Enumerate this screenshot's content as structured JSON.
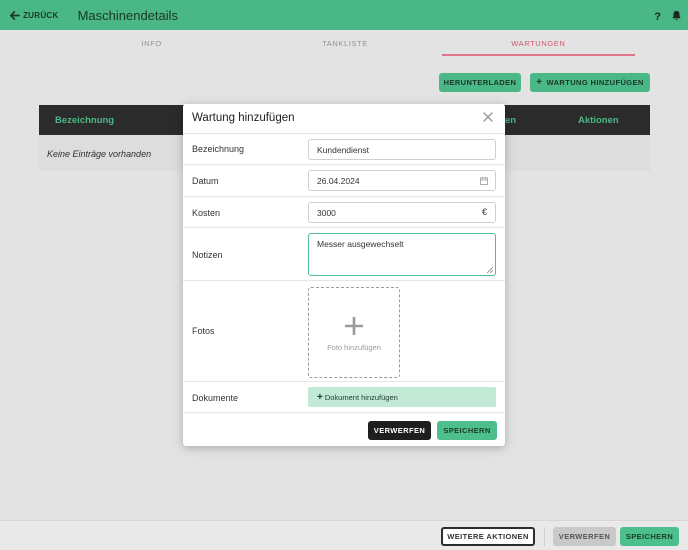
{
  "header": {
    "back_label": "ZURÜCK",
    "title": "Maschinendetails",
    "help": "?"
  },
  "tabs": [
    {
      "label": "INFO"
    },
    {
      "label": "TANKLISTE"
    },
    {
      "label": "WARTUNGEN",
      "active": true
    }
  ],
  "toolbar": {
    "download_label": "HERUNTERLADEN",
    "add_label": "WARTUNG HINZUFÜGEN"
  },
  "table": {
    "headers": {
      "bezeichnung": "Bezeichnung",
      "partial": "en",
      "aktionen": "Aktionen"
    },
    "empty_text": "Keine Einträge vorhanden"
  },
  "modal": {
    "title": "Wartung hinzufügen",
    "fields": {
      "bezeichnung": {
        "label": "Bezeichnung",
        "value": "Kundendienst"
      },
      "datum": {
        "label": "Datum",
        "value": "26.04.2024"
      },
      "kosten": {
        "label": "Kosten",
        "value": "3000",
        "unit": "€"
      },
      "notizen": {
        "label": "Notizen",
        "value": "Messer ausgewechselt"
      },
      "fotos": {
        "label": "Fotos",
        "add_label": "Foto hinzufügen"
      },
      "dokumente": {
        "label": "Dokumente",
        "add_label": "Dokument hinzufügen"
      }
    },
    "discard_label": "VERWERFEN",
    "save_label": "SPEICHERN"
  },
  "footer": {
    "more_label": "WEITERE AKTIONEN",
    "discard_label": "VERWERFEN",
    "save_label": "SPEICHERN"
  },
  "colors": {
    "accent": "#4dbf8c",
    "tab_active": "#d85c72",
    "dark": "#2d2d2d"
  }
}
